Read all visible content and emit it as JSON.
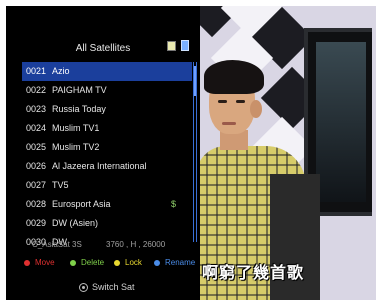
{
  "header": {
    "title": "All Satellites"
  },
  "channels": [
    {
      "num": "0021",
      "name": "Azio",
      "selected": true,
      "icon": ""
    },
    {
      "num": "0022",
      "name": "PAIGHAM TV",
      "selected": false,
      "icon": ""
    },
    {
      "num": "0023",
      "name": "Russia Today",
      "selected": false,
      "icon": ""
    },
    {
      "num": "0024",
      "name": "Muslim TV1",
      "selected": false,
      "icon": ""
    },
    {
      "num": "0025",
      "name": "Muslim TV2",
      "selected": false,
      "icon": ""
    },
    {
      "num": "0026",
      "name": "Al Jazeera International",
      "selected": false,
      "icon": ""
    },
    {
      "num": "0027",
      "name": "TV5",
      "selected": false,
      "icon": ""
    },
    {
      "num": "0028",
      "name": "Eurosport Asia",
      "selected": false,
      "icon": "$"
    },
    {
      "num": "0029",
      "name": "DW (Asien)",
      "selected": false,
      "icon": ""
    },
    {
      "num": "0030",
      "name": "DW",
      "selected": false,
      "icon": ""
    }
  ],
  "satellite": {
    "name": "C_AsiaSat 3S",
    "transponder": "3760 , H , 26000"
  },
  "legend": [
    {
      "label": "Move",
      "color": "#e03030"
    },
    {
      "label": "Delete",
      "color": "#7fd04a"
    },
    {
      "label": "Lock",
      "color": "#e8d830"
    },
    {
      "label": "Rename",
      "color": "#4a8ce8"
    }
  ],
  "footer": {
    "switch_label": "Switch Sat"
  },
  "video": {
    "subtitle": "啊窮了幾首歌"
  },
  "colors": {
    "selection": "#1b3f9c",
    "osd_background": "#000000"
  }
}
